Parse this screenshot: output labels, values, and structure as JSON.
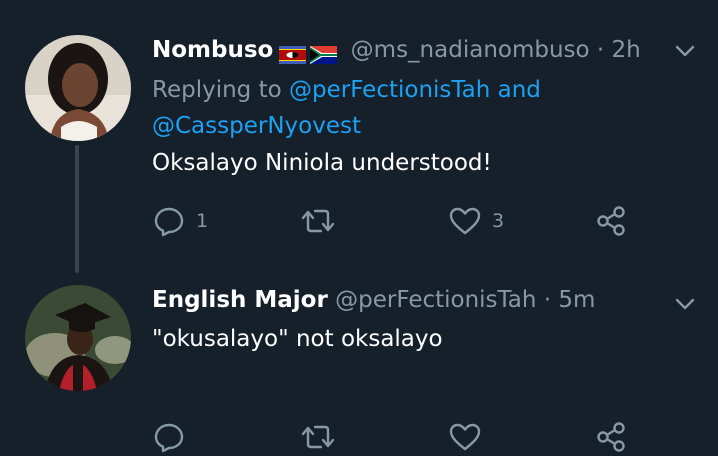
{
  "tweets": [
    {
      "name": "Nombuso",
      "flags": [
        "eswatini-flag",
        "south-africa-flag"
      ],
      "handle": "@ms_nadianombuso",
      "dot": "·",
      "time": "2h",
      "replying_prefix": "Replying to",
      "replying_to": [
        "@perFectionisTah",
        "@CassperNyovest"
      ],
      "replying_joiner": "and",
      "text": "Oksalayo Niniola understood!",
      "reply_count": "1",
      "retweet_count": "",
      "like_count": "3"
    },
    {
      "name": "English Major",
      "handle": "@perFectionisTah",
      "dot": "·",
      "time": "5m",
      "text": "\"okusalayo\" not oksalayo",
      "reply_count": "",
      "retweet_count": "",
      "like_count": ""
    }
  ],
  "icons": {
    "reply": "reply-icon",
    "retweet": "retweet-icon",
    "like": "heart-icon",
    "share": "share-icon",
    "menu": "chevron-down-icon"
  },
  "colors": {
    "background": "#15202b",
    "secondary_text": "#8899a6",
    "link": "#1da1f2",
    "thread_line": "#38444d"
  }
}
